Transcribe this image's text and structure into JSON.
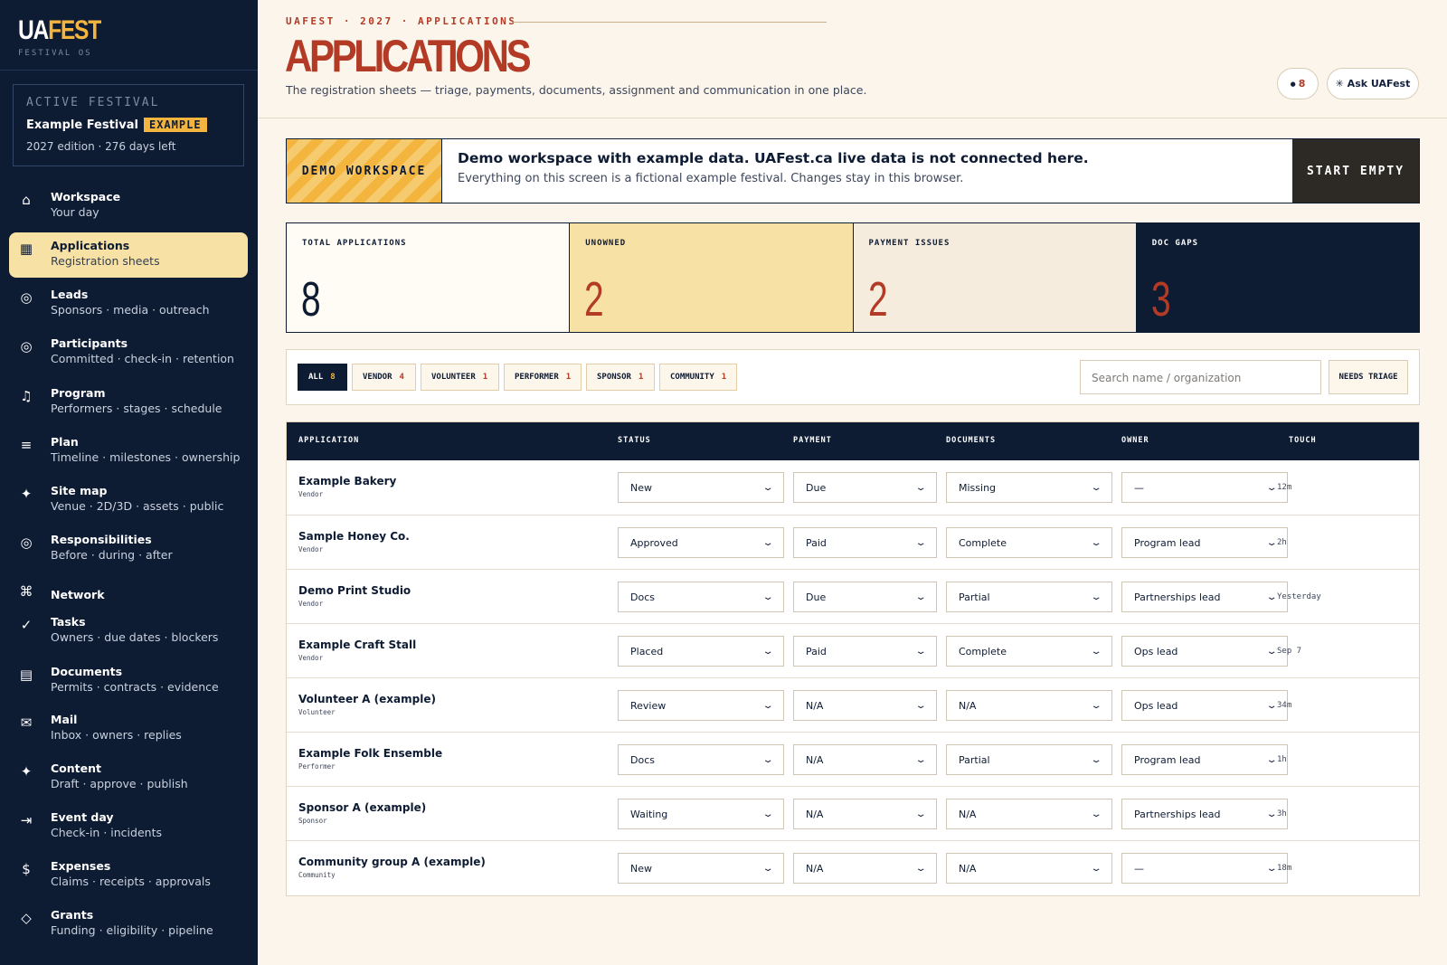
{
  "brand": {
    "logo_a": "UA",
    "logo_b": "FEST",
    "sub": "FESTIVAL OS"
  },
  "festival": {
    "label": "ACTIVE FESTIVAL",
    "name": "Example Festival",
    "tag": "EXAMPLE",
    "meta": "2027 edition · 276 days left"
  },
  "nav": [
    {
      "icon": "⌂",
      "icon_name": "home-icon",
      "title": "Workspace",
      "sub": "Your day"
    },
    {
      "icon": "▦",
      "icon_name": "grid-icon",
      "title": "Applications",
      "sub": "Registration sheets",
      "active": true
    },
    {
      "icon": "◎",
      "icon_name": "target-icon",
      "title": "Leads",
      "sub": "Sponsors · media · outreach"
    },
    {
      "icon": "◎",
      "icon_name": "target-icon",
      "title": "Participants",
      "sub": "Committed · check-in · retention"
    },
    {
      "icon": "♫",
      "icon_name": "music-icon",
      "title": "Program",
      "sub": "Performers · stages · schedule"
    },
    {
      "icon": "≡",
      "icon_name": "list-icon",
      "title": "Plan",
      "sub": "Timeline · milestones · ownership"
    },
    {
      "icon": "✦",
      "icon_name": "star-icon",
      "title": "Site map",
      "sub": "Venue · 2D/3D · assets · public"
    },
    {
      "icon": "◎",
      "icon_name": "target-icon",
      "title": "Responsibilities",
      "sub": "Before · during · after"
    },
    {
      "icon": "⌘",
      "icon_name": "command-icon",
      "title": "Network",
      "sub": ""
    },
    {
      "icon": "✓",
      "icon_name": "check-icon",
      "title": "Tasks",
      "sub": "Owners · due dates · blockers"
    },
    {
      "icon": "▤",
      "icon_name": "document-icon",
      "title": "Documents",
      "sub": "Permits · contracts · evidence"
    },
    {
      "icon": "✉",
      "icon_name": "mail-icon",
      "title": "Mail",
      "sub": "Inbox · owners · replies"
    },
    {
      "icon": "✦",
      "icon_name": "sparkle-icon",
      "title": "Content",
      "sub": "Draft · approve · publish"
    },
    {
      "icon": "⇥",
      "icon_name": "arrow-in-icon",
      "title": "Event day",
      "sub": "Check-in · incidents"
    },
    {
      "icon": "$",
      "icon_name": "dollar-icon",
      "title": "Expenses",
      "sub": "Claims · receipts · approvals"
    },
    {
      "icon": "◇",
      "icon_name": "diamond-icon",
      "title": "Grants",
      "sub": "Funding · eligibility · pipeline"
    }
  ],
  "header": {
    "crumb": "UAFEST · 2027 · APPLICATIONS",
    "title": "APPLICATIONS",
    "subtitle": "The registration sheets — triage, payments, documents, assignment and communication in one place.",
    "count_badge_dot": "●",
    "count_badge_num": "8",
    "ask_label": "✳ Ask UAFest"
  },
  "banner": {
    "stripe_label": "DEMO WORKSPACE",
    "title": "Demo workspace with example data. UAFest.ca live data is not connected here.",
    "sub": "Everything on this screen is a fictional example festival. Changes stay in this browser.",
    "button": "START EMPTY"
  },
  "stats": [
    {
      "label": "TOTAL APPLICATIONS",
      "value": "8",
      "bg": "#fffcf6",
      "fg": "#0d1b33",
      "lblfg": "#0d1b33"
    },
    {
      "label": "UNOWNED",
      "value": "2",
      "bg": "#f8e1a4",
      "fg": "#b33a25",
      "lblfg": "#0d1b33"
    },
    {
      "label": "PAYMENT ISSUES",
      "value": "2",
      "bg": "#f5ecdd",
      "fg": "#b33a25",
      "lblfg": "#0d1b33"
    },
    {
      "label": "DOC GAPS",
      "value": "3",
      "bg": "#0d1b33",
      "fg": "#b33a25",
      "lblfg": "#ffffff"
    }
  ],
  "filters": {
    "chips": [
      {
        "label": "ALL",
        "count": "8",
        "active": true
      },
      {
        "label": "VENDOR",
        "count": "4"
      },
      {
        "label": "VOLUNTEER",
        "count": "1"
      },
      {
        "label": "PERFORMER",
        "count": "1"
      },
      {
        "label": "SPONSOR",
        "count": "1"
      },
      {
        "label": "COMMUNITY",
        "count": "1"
      }
    ],
    "search_placeholder": "Search name / organization",
    "triage": "NEEDS TRIAGE"
  },
  "table": {
    "headers": [
      "APPLICATION",
      "STATUS",
      "PAYMENT",
      "DOCUMENTS",
      "OWNER",
      "TOUCH"
    ],
    "rows": [
      {
        "name": "Example Bakery",
        "type": "Vendor",
        "status": "New",
        "payment": "Due",
        "documents": "Missing",
        "owner": "—",
        "touch": "12m"
      },
      {
        "name": "Sample Honey Co.",
        "type": "Vendor",
        "status": "Approved",
        "payment": "Paid",
        "documents": "Complete",
        "owner": "Program lead",
        "touch": "2h"
      },
      {
        "name": "Demo Print Studio",
        "type": "Vendor",
        "status": "Docs",
        "payment": "Due",
        "documents": "Partial",
        "owner": "Partnerships lead",
        "touch": "Yesterday"
      },
      {
        "name": "Example Craft Stall",
        "type": "Vendor",
        "status": "Placed",
        "payment": "Paid",
        "documents": "Complete",
        "owner": "Ops lead",
        "touch": "Sep 7"
      },
      {
        "name": "Volunteer A (example)",
        "type": "Volunteer",
        "status": "Review",
        "payment": "N/A",
        "documents": "N/A",
        "owner": "Ops lead",
        "touch": "34m"
      },
      {
        "name": "Example Folk Ensemble",
        "type": "Performer",
        "status": "Docs",
        "payment": "N/A",
        "documents": "Partial",
        "owner": "Program lead",
        "touch": "1h"
      },
      {
        "name": "Sponsor A (example)",
        "type": "Sponsor",
        "status": "Waiting",
        "payment": "N/A",
        "documents": "N/A",
        "owner": "Partnerships lead",
        "touch": "3h"
      },
      {
        "name": "Community group A (example)",
        "type": "Community",
        "status": "New",
        "payment": "N/A",
        "documents": "N/A",
        "owner": "—",
        "touch": "18m"
      }
    ]
  }
}
